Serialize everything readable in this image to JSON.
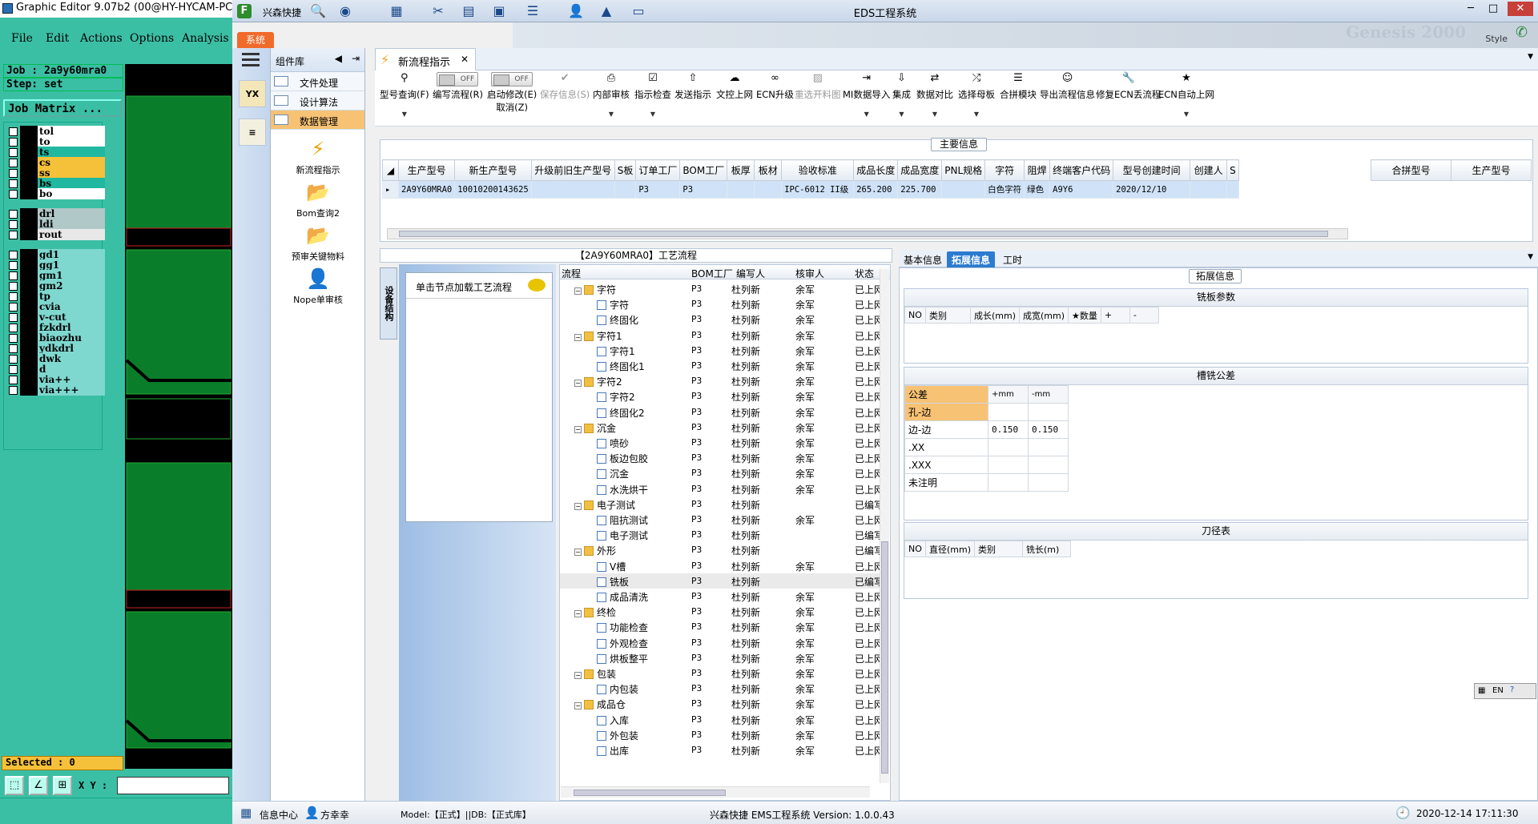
{
  "graphic_editor": {
    "title": "Graphic Editor 9.07b2 (00@HY-HYCAM-PC185",
    "menu": [
      "File",
      "Edit",
      "Actions",
      "Options",
      "Analysis"
    ],
    "job": "Job : 2a9y60mra0",
    "step": "Step: set",
    "job_matrix": "Job Matrix ...",
    "layers": [
      {
        "name": "tol",
        "color": "#ffffff"
      },
      {
        "name": "to",
        "color": "#ffffff"
      },
      {
        "name": "ts",
        "color": "#20b8a0"
      },
      {
        "name": "cs",
        "color": "#f6c13a"
      },
      {
        "name": "ss",
        "color": "#f6c13a"
      },
      {
        "name": "bs",
        "color": "#20b8a0"
      },
      {
        "name": "bo",
        "color": "#ffffff"
      },
      {
        "name": "drl",
        "color": "#b0c8c8"
      },
      {
        "name": "ldi",
        "color": "#b0c8c8"
      },
      {
        "name": "rout",
        "color": "#e8e8e8"
      },
      {
        "name": "gd1",
        "color": "#7fd8d0"
      },
      {
        "name": "gg1",
        "color": "#7fd8d0"
      },
      {
        "name": "gm1",
        "color": "#7fd8d0"
      },
      {
        "name": "gm2",
        "color": "#7fd8d0"
      },
      {
        "name": "tp",
        "color": "#7fd8d0"
      },
      {
        "name": "cvia",
        "color": "#7fd8d0"
      },
      {
        "name": "v-cut",
        "color": "#7fd8d0"
      },
      {
        "name": "fzkdrl",
        "color": "#7fd8d0"
      },
      {
        "name": "biaozhu",
        "color": "#7fd8d0"
      },
      {
        "name": "ydkdrl",
        "color": "#7fd8d0"
      },
      {
        "name": "dwk",
        "color": "#7fd8d0"
      },
      {
        "name": "d",
        "color": "#7fd8d0"
      },
      {
        "name": "via++",
        "color": "#7fd8d0"
      },
      {
        "name": "via+++",
        "color": "#7fd8d0"
      }
    ],
    "selected": "Selected : 0",
    "xy_label": "X Y :"
  },
  "eds": {
    "quick_label": "兴森快捷",
    "window_title": "EDS工程系统",
    "system_tab": "系统",
    "banner_text": "Genesis 2000",
    "banner_style": "Style",
    "left_nav": [
      "YX",
      "≡"
    ],
    "component_library": {
      "header": "组件库",
      "categories": [
        "文件处理",
        "设计算法",
        "数据管理"
      ],
      "selected_category": "数据管理",
      "tools": [
        "新流程指示",
        "Bom查询2",
        "预审关键物料",
        "Nope单审核"
      ]
    },
    "doc_tab": "新流程指示",
    "toolbar": [
      {
        "label": "型号查询(F)",
        "icon": "search-icon",
        "dd": true
      },
      {
        "label": "编写流程(R)",
        "icon": "toggle",
        "toggle": "OFF"
      },
      {
        "label": "启动修改(E)",
        "sub": "取消(Z)",
        "icon": "toggle",
        "toggle": "OFF"
      },
      {
        "label": "保存信息(S)",
        "icon": "check-icon",
        "disabled": true
      },
      {
        "label": "内部审核",
        "icon": "printer-icon",
        "dd": true
      },
      {
        "label": "指示检查",
        "icon": "check-box-icon",
        "dd": true
      },
      {
        "label": "发送指示",
        "icon": "upload-icon"
      },
      {
        "label": "文控上网",
        "icon": "cloud-upload-icon"
      },
      {
        "label": "ECN升级",
        "icon": "binoculars-icon"
      },
      {
        "label": "重选开料图",
        "icon": "image-icon",
        "disabled": true
      },
      {
        "label": "MI数据导入",
        "icon": "import-icon",
        "dd": true
      },
      {
        "label": "集成",
        "icon": "download-icon",
        "dd": true
      },
      {
        "label": "数据对比",
        "icon": "compare-icon",
        "dd": true
      },
      {
        "label": "选择母板",
        "icon": "shuffle-icon",
        "dd": true
      },
      {
        "label": "合拼模块",
        "icon": "list-icon"
      },
      {
        "label": "导出流程信息",
        "icon": "smile-icon"
      },
      {
        "label": "修复ECN丢流程",
        "icon": "wrench-icon"
      },
      {
        "label": "ECN自动上网",
        "icon": "star-icon",
        "dd": true
      }
    ],
    "main_info": {
      "label": "主要信息",
      "columns": [
        "生产型号",
        "新生产型号",
        "升级前旧生产型号",
        "S板",
        "订单工厂",
        "BOM工厂",
        "板厚",
        "板材",
        "验收标准",
        "成品长度",
        "成品宽度",
        "PNL规格",
        "字符",
        "阻焊",
        "终端客户代码",
        "型号创建时间",
        "创建人",
        "S"
      ],
      "row": [
        "2A9Y60MRA0",
        "10010200143625",
        "",
        "",
        "P3",
        "P3",
        "",
        "",
        "IPC-6012 II级",
        "265.200",
        "225.700",
        "",
        "白色字符",
        "绿色",
        "A9Y6",
        "2020/12/10",
        "",
        ""
      ],
      "right_columns": [
        "合拼型号",
        "生产型号"
      ]
    },
    "flow": {
      "title": "【2A9Y60MRA0】工艺流程",
      "side_tab": "设备结构",
      "note": "单击节点加载工艺流程",
      "columns": [
        "流程",
        "BOM工厂",
        "编写人",
        "核审人",
        "状态"
      ],
      "rows": [
        {
          "lvl": 0,
          "type": "folder",
          "name": "字符",
          "bom": "P3",
          "writer": "杜列新",
          "reviewer": "余军",
          "status": "已上网"
        },
        {
          "lvl": 1,
          "type": "doc",
          "name": "字符",
          "bom": "P3",
          "writer": "杜列新",
          "reviewer": "余军",
          "status": "已上网"
        },
        {
          "lvl": 1,
          "type": "doc",
          "name": "终固化",
          "bom": "P3",
          "writer": "杜列新",
          "reviewer": "余军",
          "status": "已上网"
        },
        {
          "lvl": 0,
          "type": "folder",
          "name": "字符1",
          "bom": "P3",
          "writer": "杜列新",
          "reviewer": "余军",
          "status": "已上网"
        },
        {
          "lvl": 1,
          "type": "doc",
          "name": "字符1",
          "bom": "P3",
          "writer": "杜列新",
          "reviewer": "余军",
          "status": "已上网"
        },
        {
          "lvl": 1,
          "type": "doc",
          "name": "终固化1",
          "bom": "P3",
          "writer": "杜列新",
          "reviewer": "余军",
          "status": "已上网"
        },
        {
          "lvl": 0,
          "type": "folder",
          "name": "字符2",
          "bom": "P3",
          "writer": "杜列新",
          "reviewer": "余军",
          "status": "已上网"
        },
        {
          "lvl": 1,
          "type": "doc",
          "name": "字符2",
          "bom": "P3",
          "writer": "杜列新",
          "reviewer": "余军",
          "status": "已上网"
        },
        {
          "lvl": 1,
          "type": "doc",
          "name": "终固化2",
          "bom": "P3",
          "writer": "杜列新",
          "reviewer": "余军",
          "status": "已上网"
        },
        {
          "lvl": 0,
          "type": "folder",
          "name": "沉金",
          "bom": "P3",
          "writer": "杜列新",
          "reviewer": "余军",
          "status": "已上网"
        },
        {
          "lvl": 1,
          "type": "doc",
          "name": "喷砂",
          "bom": "P3",
          "writer": "杜列新",
          "reviewer": "余军",
          "status": "已上网"
        },
        {
          "lvl": 1,
          "type": "doc",
          "name": "板边包胶",
          "bom": "P3",
          "writer": "杜列新",
          "reviewer": "余军",
          "status": "已上网"
        },
        {
          "lvl": 1,
          "type": "doc",
          "name": "沉金",
          "bom": "P3",
          "writer": "杜列新",
          "reviewer": "余军",
          "status": "已上网"
        },
        {
          "lvl": 1,
          "type": "doc",
          "name": "水洗烘干",
          "bom": "P3",
          "writer": "杜列新",
          "reviewer": "余军",
          "status": "已上网"
        },
        {
          "lvl": 0,
          "type": "folder",
          "name": "电子测试",
          "bom": "P3",
          "writer": "杜列新",
          "reviewer": "",
          "status": "已编写"
        },
        {
          "lvl": 1,
          "type": "doc",
          "name": "阻抗测试",
          "bom": "P3",
          "writer": "杜列新",
          "reviewer": "余军",
          "status": "已上网"
        },
        {
          "lvl": 1,
          "type": "doc",
          "name": "电子测试",
          "bom": "P3",
          "writer": "杜列新",
          "reviewer": "",
          "status": "已编写"
        },
        {
          "lvl": 0,
          "type": "folder",
          "name": "外形",
          "bom": "P3",
          "writer": "杜列新",
          "reviewer": "",
          "status": "已编写"
        },
        {
          "lvl": 1,
          "type": "doc",
          "name": "V槽",
          "bom": "P3",
          "writer": "杜列新",
          "reviewer": "余军",
          "status": "已上网"
        },
        {
          "lvl": 1,
          "type": "doc",
          "name": "铣板",
          "bom": "P3",
          "writer": "杜列新",
          "reviewer": "",
          "status": "已编写",
          "hl": true
        },
        {
          "lvl": 1,
          "type": "doc",
          "name": "成品清洗",
          "bom": "P3",
          "writer": "杜列新",
          "reviewer": "余军",
          "status": "已上网"
        },
        {
          "lvl": 0,
          "type": "folder",
          "name": "终检",
          "bom": "P3",
          "writer": "杜列新",
          "reviewer": "余军",
          "status": "已上网"
        },
        {
          "lvl": 1,
          "type": "doc",
          "name": "功能检查",
          "bom": "P3",
          "writer": "杜列新",
          "reviewer": "余军",
          "status": "已上网"
        },
        {
          "lvl": 1,
          "type": "doc",
          "name": "外观检查",
          "bom": "P3",
          "writer": "杜列新",
          "reviewer": "余军",
          "status": "已上网"
        },
        {
          "lvl": 1,
          "type": "doc",
          "name": "烘板整平",
          "bom": "P3",
          "writer": "杜列新",
          "reviewer": "余军",
          "status": "已上网"
        },
        {
          "lvl": 0,
          "type": "folder",
          "name": "包装",
          "bom": "P3",
          "writer": "杜列新",
          "reviewer": "余军",
          "status": "已上网"
        },
        {
          "lvl": 1,
          "type": "doc",
          "name": "内包装",
          "bom": "P3",
          "writer": "杜列新",
          "reviewer": "余军",
          "status": "已上网"
        },
        {
          "lvl": 0,
          "type": "folder",
          "name": "成品仓",
          "bom": "P3",
          "writer": "杜列新",
          "reviewer": "余军",
          "status": "已上网"
        },
        {
          "lvl": 1,
          "type": "doc",
          "name": "入库",
          "bom": "P3",
          "writer": "杜列新",
          "reviewer": "余军",
          "status": "已上网"
        },
        {
          "lvl": 1,
          "type": "doc",
          "name": "外包装",
          "bom": "P3",
          "writer": "杜列新",
          "reviewer": "余军",
          "status": "已上网"
        },
        {
          "lvl": 1,
          "type": "doc",
          "name": "出库",
          "bom": "P3",
          "writer": "杜列新",
          "reviewer": "余军",
          "status": "已上网"
        }
      ]
    },
    "right_tabs": [
      "基本信息",
      "拓展信息",
      "工时"
    ],
    "active_right_tab": "拓展信息",
    "ext_label": "拓展信息",
    "mill_params": {
      "title": "铣板参数",
      "columns": [
        "NO",
        "类别",
        "成长(mm)",
        "成宽(mm)",
        "★数量",
        "+",
        "-"
      ]
    },
    "slot_tolerance": {
      "title": "槽铣公差",
      "header": [
        "公差",
        "+mm",
        "-mm"
      ],
      "rows": [
        [
          "孔-边",
          "",
          ""
        ],
        [
          "边-边",
          "0.150",
          "0.150"
        ],
        [
          ".XX",
          "",
          ""
        ],
        [
          ".XXX",
          "",
          ""
        ],
        [
          "未注明",
          "",
          ""
        ]
      ]
    },
    "tool_table": {
      "title": "刀径表",
      "columns": [
        "NO",
        "直径(mm)",
        "类别",
        "铣长(m)"
      ]
    },
    "ime": "EN",
    "status": {
      "info_center": "信息中心",
      "user": "方幸幸",
      "model": "Model:【正式】||DB:【正式库】",
      "system": "兴森快捷 EMS工程系统 Version: 1.0.0.43",
      "datetime": "2020-12-14 17:11:30"
    }
  }
}
